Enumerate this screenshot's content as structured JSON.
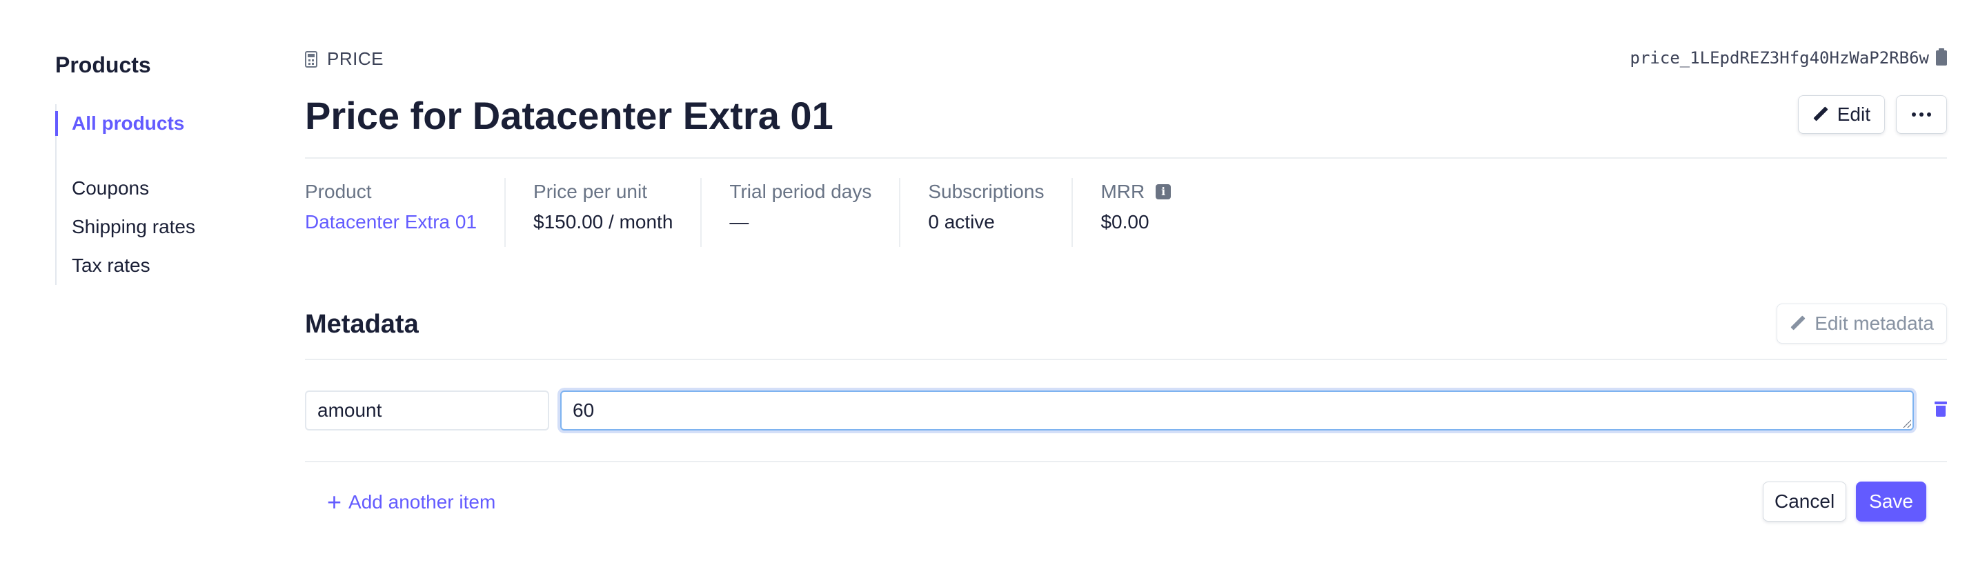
{
  "sidebar": {
    "title": "Products",
    "items": [
      {
        "label": "All products",
        "active": true
      },
      {
        "label": "Coupons"
      },
      {
        "label": "Shipping rates"
      },
      {
        "label": "Tax rates"
      }
    ]
  },
  "header": {
    "kind_label": "PRICE",
    "kind_icon": "calculator-icon",
    "price_id": "price_1LEpdREZ3Hfg40HzWaP2RB6w",
    "copy_icon": "clipboard-icon",
    "title": "Price for Datacenter Extra 01",
    "edit_label": "Edit",
    "more_icon": "more-horizontal-icon"
  },
  "stats": [
    {
      "label": "Product",
      "value": "Datacenter Extra 01",
      "link": true
    },
    {
      "label": "Price per unit",
      "value": "$150.00 / month"
    },
    {
      "label": "Trial period days",
      "value": "—"
    },
    {
      "label": "Subscriptions",
      "value": "0 active"
    },
    {
      "label": "MRR",
      "value": "$0.00",
      "info_icon": "info-icon"
    }
  ],
  "metadata": {
    "title": "Metadata",
    "edit_label": "Edit metadata",
    "items": [
      {
        "key": "amount",
        "value": "60"
      }
    ],
    "add_label": "Add another item",
    "cancel_label": "Cancel",
    "save_label": "Save"
  },
  "colors": {
    "accent": "#635bff",
    "text": "#1a1f36",
    "muted": "#687385",
    "focus_ring": "#7eb3f0"
  }
}
